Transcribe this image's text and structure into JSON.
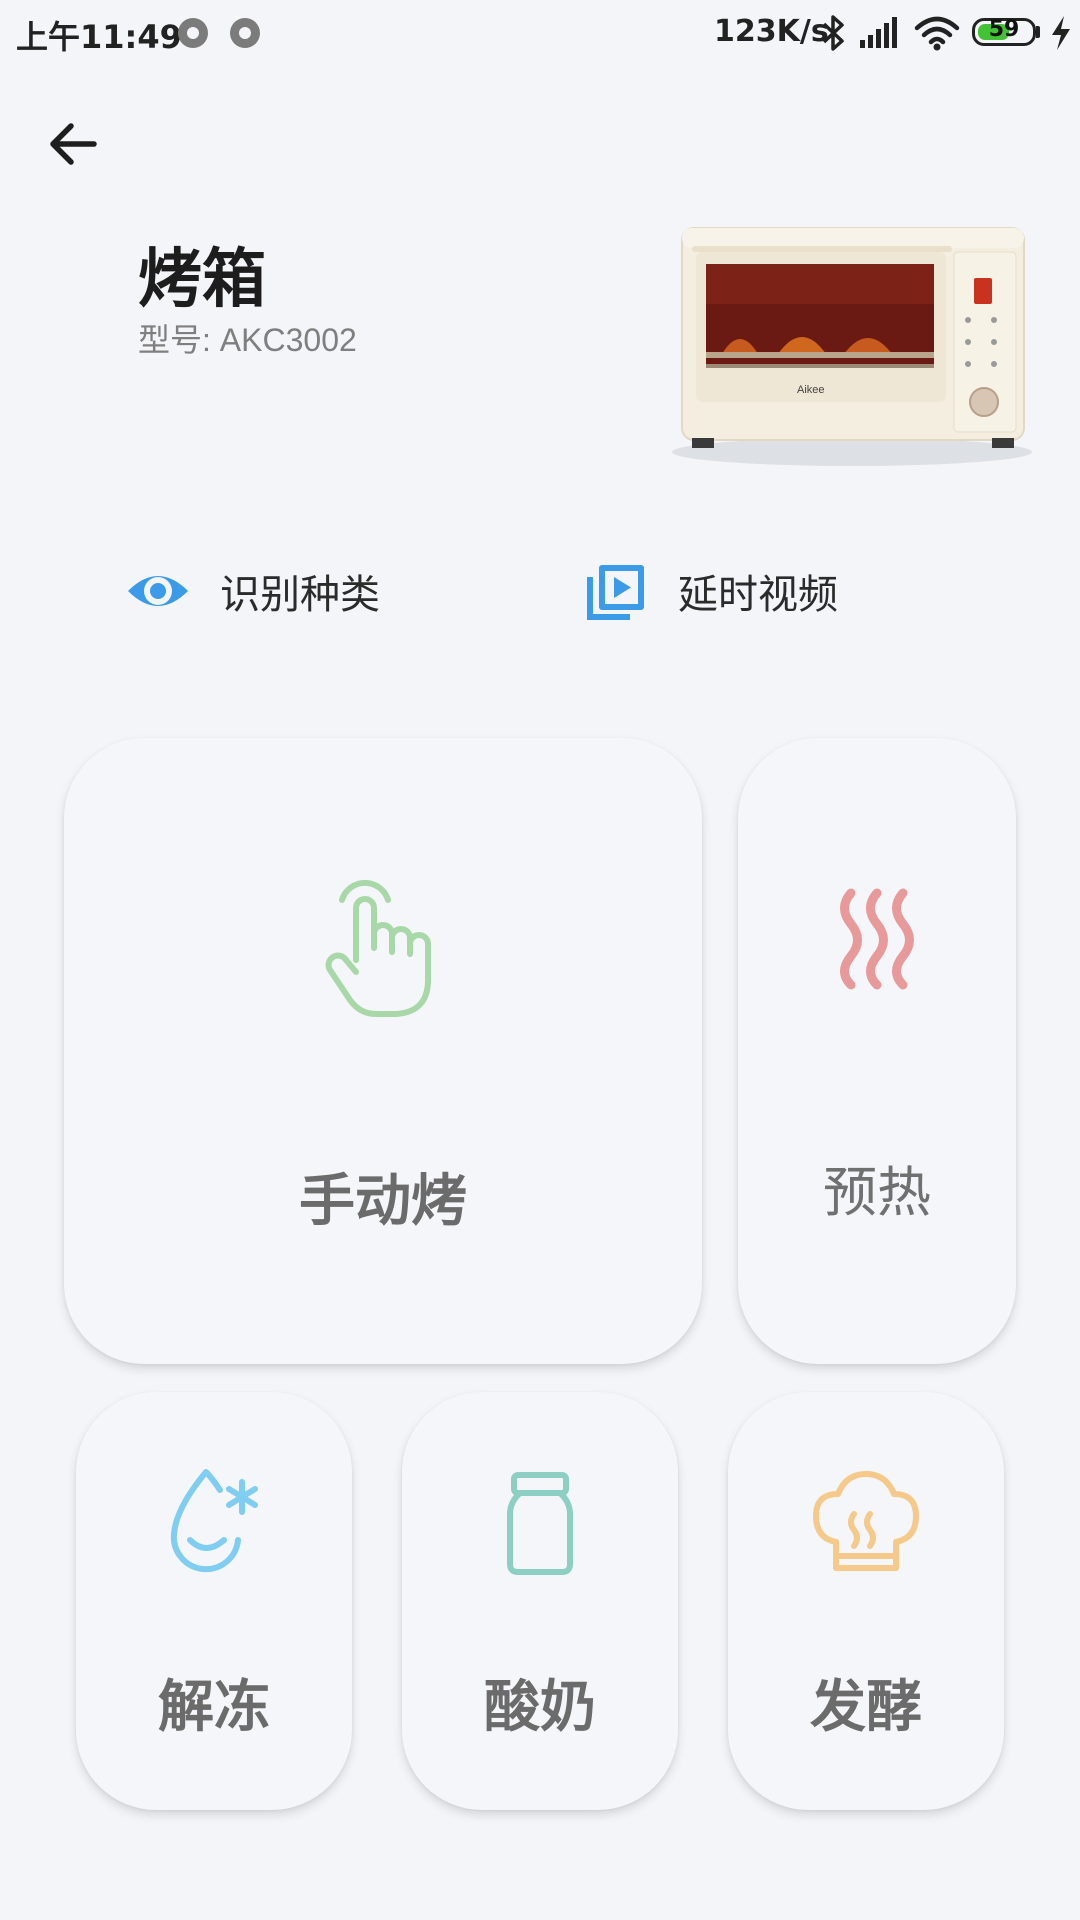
{
  "status_bar": {
    "time": "上午11:49",
    "speed": "123K/s",
    "battery_level": "59",
    "battery_fraction": 0.59,
    "battery_color": "#44c235"
  },
  "header": {
    "back_icon": "arrow-left-icon",
    "title": "烤箱",
    "model_label": "型号:",
    "model_value": "AKC3002",
    "oven_brand": "Aikee"
  },
  "quick_actions": [
    {
      "label": "识别种类",
      "icon": "eye-icon",
      "color": "#3b9be8"
    },
    {
      "label": "延时视频",
      "icon": "video-library-icon",
      "color": "#3b9be8"
    }
  ],
  "modes": {
    "manual": {
      "label": "手动烤",
      "icon": "hand-pointer-icon",
      "color": "#a8d8a8"
    },
    "preheat": {
      "label": "预热",
      "icon": "heat-waves-icon",
      "color": "#e89a9a"
    },
    "defrost": {
      "label": "解冻",
      "icon": "water-drop-snow-icon",
      "color": "#7fcdf0"
    },
    "yogurt": {
      "label": "酸奶",
      "icon": "jar-icon",
      "color": "#8ecfc4"
    },
    "ferment": {
      "label": "发酵",
      "icon": "bread-icon",
      "color": "#f5c98a"
    }
  }
}
